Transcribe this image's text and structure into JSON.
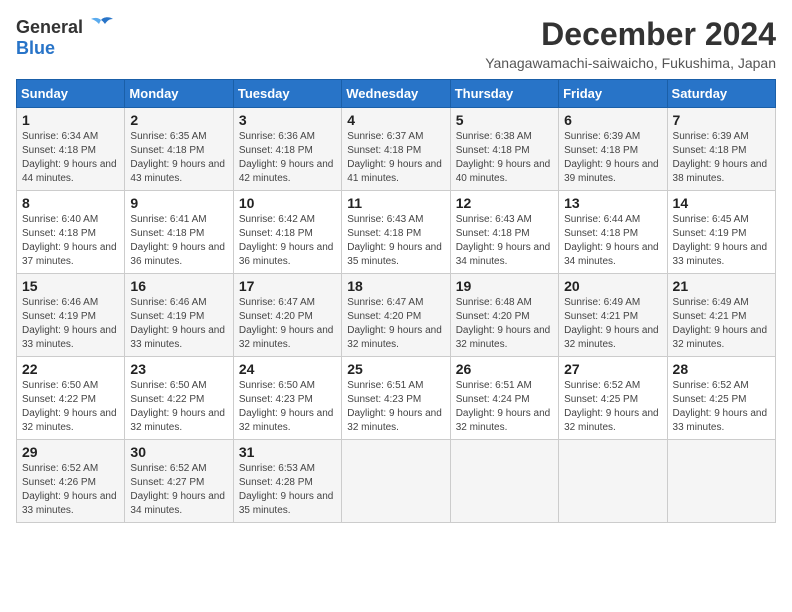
{
  "logo": {
    "general": "General",
    "blue": "Blue"
  },
  "title": "December 2024",
  "location": "Yanagawamachi-saiwaicho, Fukushima, Japan",
  "days_of_week": [
    "Sunday",
    "Monday",
    "Tuesday",
    "Wednesday",
    "Thursday",
    "Friday",
    "Saturday"
  ],
  "weeks": [
    [
      {
        "day": "1",
        "sunrise": "6:34 AM",
        "sunset": "4:18 PM",
        "daylight": "9 hours and 44 minutes."
      },
      {
        "day": "2",
        "sunrise": "6:35 AM",
        "sunset": "4:18 PM",
        "daylight": "9 hours and 43 minutes."
      },
      {
        "day": "3",
        "sunrise": "6:36 AM",
        "sunset": "4:18 PM",
        "daylight": "9 hours and 42 minutes."
      },
      {
        "day": "4",
        "sunrise": "6:37 AM",
        "sunset": "4:18 PM",
        "daylight": "9 hours and 41 minutes."
      },
      {
        "day": "5",
        "sunrise": "6:38 AM",
        "sunset": "4:18 PM",
        "daylight": "9 hours and 40 minutes."
      },
      {
        "day": "6",
        "sunrise": "6:39 AM",
        "sunset": "4:18 PM",
        "daylight": "9 hours and 39 minutes."
      },
      {
        "day": "7",
        "sunrise": "6:39 AM",
        "sunset": "4:18 PM",
        "daylight": "9 hours and 38 minutes."
      }
    ],
    [
      {
        "day": "8",
        "sunrise": "6:40 AM",
        "sunset": "4:18 PM",
        "daylight": "9 hours and 37 minutes."
      },
      {
        "day": "9",
        "sunrise": "6:41 AM",
        "sunset": "4:18 PM",
        "daylight": "9 hours and 36 minutes."
      },
      {
        "day": "10",
        "sunrise": "6:42 AM",
        "sunset": "4:18 PM",
        "daylight": "9 hours and 36 minutes."
      },
      {
        "day": "11",
        "sunrise": "6:43 AM",
        "sunset": "4:18 PM",
        "daylight": "9 hours and 35 minutes."
      },
      {
        "day": "12",
        "sunrise": "6:43 AM",
        "sunset": "4:18 PM",
        "daylight": "9 hours and 34 minutes."
      },
      {
        "day": "13",
        "sunrise": "6:44 AM",
        "sunset": "4:18 PM",
        "daylight": "9 hours and 34 minutes."
      },
      {
        "day": "14",
        "sunrise": "6:45 AM",
        "sunset": "4:19 PM",
        "daylight": "9 hours and 33 minutes."
      }
    ],
    [
      {
        "day": "15",
        "sunrise": "6:46 AM",
        "sunset": "4:19 PM",
        "daylight": "9 hours and 33 minutes."
      },
      {
        "day": "16",
        "sunrise": "6:46 AM",
        "sunset": "4:19 PM",
        "daylight": "9 hours and 33 minutes."
      },
      {
        "day": "17",
        "sunrise": "6:47 AM",
        "sunset": "4:20 PM",
        "daylight": "9 hours and 32 minutes."
      },
      {
        "day": "18",
        "sunrise": "6:47 AM",
        "sunset": "4:20 PM",
        "daylight": "9 hours and 32 minutes."
      },
      {
        "day": "19",
        "sunrise": "6:48 AM",
        "sunset": "4:20 PM",
        "daylight": "9 hours and 32 minutes."
      },
      {
        "day": "20",
        "sunrise": "6:49 AM",
        "sunset": "4:21 PM",
        "daylight": "9 hours and 32 minutes."
      },
      {
        "day": "21",
        "sunrise": "6:49 AM",
        "sunset": "4:21 PM",
        "daylight": "9 hours and 32 minutes."
      }
    ],
    [
      {
        "day": "22",
        "sunrise": "6:50 AM",
        "sunset": "4:22 PM",
        "daylight": "9 hours and 32 minutes."
      },
      {
        "day": "23",
        "sunrise": "6:50 AM",
        "sunset": "4:22 PM",
        "daylight": "9 hours and 32 minutes."
      },
      {
        "day": "24",
        "sunrise": "6:50 AM",
        "sunset": "4:23 PM",
        "daylight": "9 hours and 32 minutes."
      },
      {
        "day": "25",
        "sunrise": "6:51 AM",
        "sunset": "4:23 PM",
        "daylight": "9 hours and 32 minutes."
      },
      {
        "day": "26",
        "sunrise": "6:51 AM",
        "sunset": "4:24 PM",
        "daylight": "9 hours and 32 minutes."
      },
      {
        "day": "27",
        "sunrise": "6:52 AM",
        "sunset": "4:25 PM",
        "daylight": "9 hours and 32 minutes."
      },
      {
        "day": "28",
        "sunrise": "6:52 AM",
        "sunset": "4:25 PM",
        "daylight": "9 hours and 33 minutes."
      }
    ],
    [
      {
        "day": "29",
        "sunrise": "6:52 AM",
        "sunset": "4:26 PM",
        "daylight": "9 hours and 33 minutes."
      },
      {
        "day": "30",
        "sunrise": "6:52 AM",
        "sunset": "4:27 PM",
        "daylight": "9 hours and 34 minutes."
      },
      {
        "day": "31",
        "sunrise": "6:53 AM",
        "sunset": "4:28 PM",
        "daylight": "9 hours and 35 minutes."
      },
      null,
      null,
      null,
      null
    ]
  ],
  "labels": {
    "sunrise": "Sunrise:",
    "sunset": "Sunset:",
    "daylight": "Daylight:"
  }
}
